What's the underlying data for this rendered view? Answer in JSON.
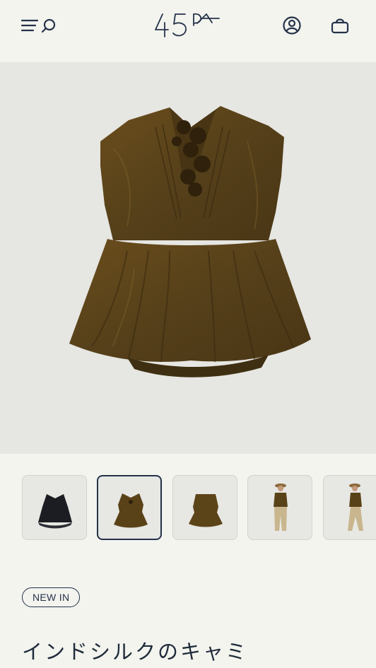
{
  "header": {
    "logo_text": "45R",
    "icons": [
      "menu-icon",
      "search-icon",
      "account-icon",
      "cart-icon"
    ]
  },
  "hero": {
    "alt": "brown silk camisole"
  },
  "thumbnails": {
    "selected_index": 1,
    "count": 5
  },
  "product": {
    "badge": "NEW IN",
    "title": "インドシルクのキャミ"
  },
  "colors": {
    "background": "#f3f4ee",
    "navy": "#25324a",
    "garment_brown": "#5e4419"
  }
}
